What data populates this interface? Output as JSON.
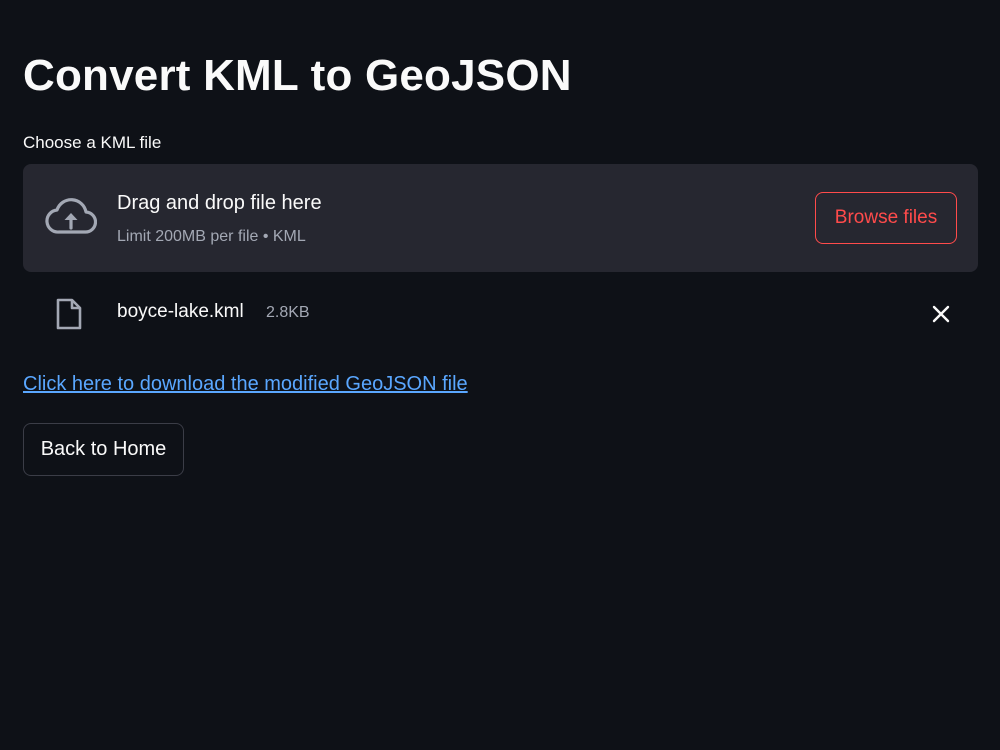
{
  "page": {
    "title": "Convert KML to GeoJSON"
  },
  "uploader": {
    "label": "Choose a KML file",
    "drop_text": "Drag and drop file here",
    "limit_text": "Limit 200MB per file • KML",
    "browse_label": "Browse files",
    "icon": "cloud-upload-icon"
  },
  "uploaded_file": {
    "name": "boyce-lake.kml",
    "size": "2.8KB",
    "icon": "file-icon",
    "remove_icon": "close-icon"
  },
  "download": {
    "link_text": "Click here to download the modified GeoJSON file"
  },
  "actions": {
    "back_label": "Back to Home"
  },
  "colors": {
    "background": "#0e1117",
    "dropzone": "#262730",
    "accent": "#ff4b4b",
    "link": "#5aa7ff",
    "muted_text": "#a3a8b4"
  }
}
